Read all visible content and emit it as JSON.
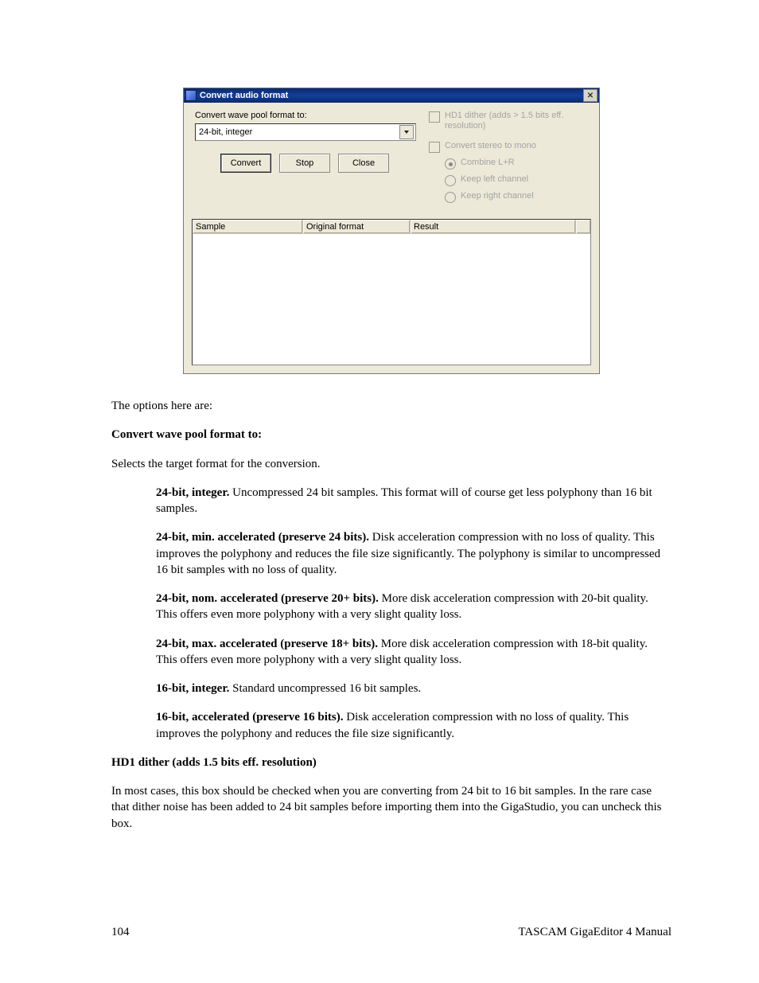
{
  "dialog": {
    "title": "Convert audio format",
    "close_aria": "Close",
    "format_label": "Convert wave pool format to:",
    "format_value": "24-bit, integer",
    "buttons": {
      "convert": "Convert",
      "stop": "Stop",
      "close": "Close"
    },
    "opts": {
      "hd1": "HD1 dither (adds > 1.5 bits eff. resolution)",
      "stereo": "Convert stereo to mono",
      "combine": "Combine L+R",
      "keepL": "Keep left channel",
      "keepR": "Keep right channel"
    },
    "cols": {
      "sample": "Sample",
      "orig": "Original format",
      "result": "Result"
    }
  },
  "body": {
    "intro": "The options here are:",
    "h1": "Convert wave pool format to:",
    "p1": "Selects the target format for the conversion.",
    "opts": [
      {
        "lead": "24-bit, integer.",
        "text": "  Uncompressed 24 bit samples. This format will of course get less polyphony than 16 bit samples."
      },
      {
        "lead": "24-bit, min. accelerated (preserve 24 bits).",
        "text": "  Disk acceleration compression with no loss of quality. This improves the polyphony and reduces the file size significantly. The polyphony is similar to uncompressed 16 bit samples with no loss of quality."
      },
      {
        "lead": "24-bit, nom. accelerated (preserve 20+ bits).",
        "text": "  More disk acceleration compression with 20-bit quality. This offers even more polyphony with a very slight quality loss."
      },
      {
        "lead": "24-bit, max. accelerated (preserve 18+ bits).",
        "text": "  More disk acceleration compression with 18-bit quality. This offers even more polyphony with a very slight quality loss."
      },
      {
        "lead": "16-bit, integer.",
        "text": "  Standard uncompressed 16 bit samples."
      },
      {
        "lead": "16-bit, accelerated (preserve 16 bits).",
        "text": "  Disk acceleration compression with no loss of quality. This improves the polyphony and reduces the file size significantly."
      }
    ],
    "h2": "HD1 dither (adds 1.5 bits eff. resolution)",
    "p2": "In most cases, this box should be checked when you are converting from 24 bit to 16 bit samples. In the rare case that dither noise has been added to 24 bit samples before importing them into the GigaStudio, you can uncheck this box."
  },
  "footer": {
    "page": "104",
    "manual": "TASCAM GigaEditor 4 Manual"
  }
}
